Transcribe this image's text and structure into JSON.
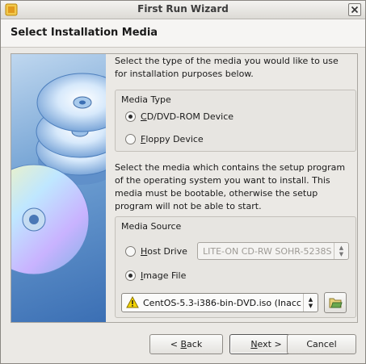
{
  "window": {
    "title": "First Run Wizard"
  },
  "header": {
    "title": "Select Installation Media"
  },
  "intro": {
    "line1": "Select the type of the media you would like to use",
    "line2": "for installation purposes below."
  },
  "media_type": {
    "label": "Media Type",
    "options": [
      {
        "prefix": "",
        "accel": "C",
        "rest": "D/DVD-ROM Device",
        "selected": true
      },
      {
        "prefix": "",
        "accel": "F",
        "rest": "loppy Device",
        "selected": false
      }
    ]
  },
  "description": {
    "line1": "Select the media which contains the setup program",
    "line2": "of the operating system you want to install. This",
    "line3": "media must be bootable, otherwise the setup",
    "line4": "program will not be able to start."
  },
  "media_source": {
    "label": "Media Source",
    "host_drive": {
      "prefix": "",
      "accel": "H",
      "rest": "ost Drive",
      "selected": false,
      "value": "LITE-ON CD-RW SOHR-5238S"
    },
    "image_file": {
      "prefix": "",
      "accel": "I",
      "rest": "mage File",
      "selected": true,
      "value": "CentOS-5.3-i386-bin-DVD.iso (Inacc"
    }
  },
  "buttons": {
    "back": {
      "prefix": "< ",
      "accel": "B",
      "rest": "ack"
    },
    "next": {
      "prefix": "",
      "accel": "N",
      "rest": "ext >"
    },
    "cancel": {
      "label": "Cancel"
    }
  },
  "icons": {
    "app": "virtualbox-icon",
    "close": "close-icon",
    "warning": "warning-icon",
    "folder": "open-folder-icon",
    "side": "discs-illustration"
  },
  "colors": {
    "warning": "#f4d400",
    "folder": "#6aa84f"
  }
}
